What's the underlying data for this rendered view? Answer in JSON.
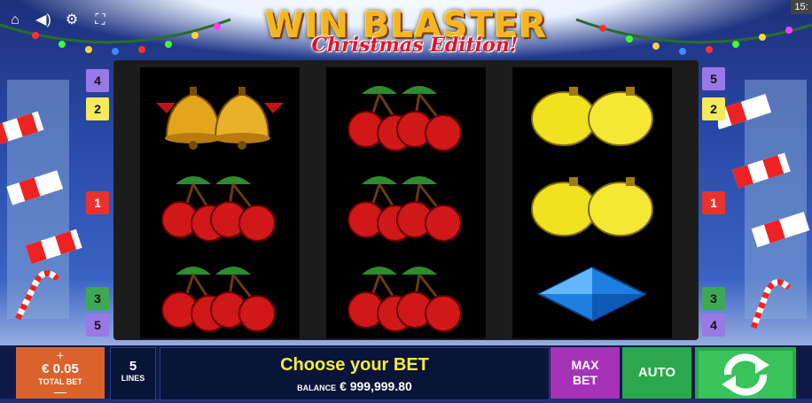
{
  "game": {
    "title_main": "WIN BLASTER",
    "title_sub": "Christmas Edition!"
  },
  "status_bar": {
    "clock": "15:"
  },
  "top_icons": [
    "home-icon",
    "sound-icon",
    "settings-icon",
    "fullscreen-icon"
  ],
  "paylines": {
    "left": [
      {
        "label": "4",
        "color": "#9a78e8"
      },
      {
        "label": "2",
        "color": "#f4ea5a"
      },
      {
        "label": "1",
        "color": "#e8322e"
      },
      {
        "label": "3",
        "color": "#3ea955"
      },
      {
        "label": "5",
        "color": "#9a78e8"
      }
    ],
    "right": [
      {
        "label": "5",
        "color": "#9a78e8"
      },
      {
        "label": "2",
        "color": "#f4ea5a"
      },
      {
        "label": "1",
        "color": "#e8322e"
      },
      {
        "label": "3",
        "color": "#3ea955"
      },
      {
        "label": "4",
        "color": "#9a78e8"
      }
    ]
  },
  "reels": [
    [
      "bells",
      "cherries",
      "cherries"
    ],
    [
      "cherries",
      "cherries",
      "cherries"
    ],
    [
      "lemons",
      "lemons",
      "diamond"
    ]
  ],
  "controls": {
    "bet_plus": "+",
    "bet_value": "€ 0.05",
    "bet_label": "TOTAL BET",
    "bet_minus": "—",
    "lines_value": "5",
    "lines_label": "LINES",
    "message": "Choose your BET",
    "balance_label": "BALANCE",
    "balance_value": "€ 999,999.80",
    "maxbet_line1": "MAX",
    "maxbet_line2": "BET",
    "auto_label": "AUTO",
    "spin_icon": "spin-arrows-icon"
  },
  "colors": {
    "bet": "#d9632a",
    "maxbet": "#a632b8",
    "auto": "#2aa84b",
    "message": "#f6ed3a"
  }
}
